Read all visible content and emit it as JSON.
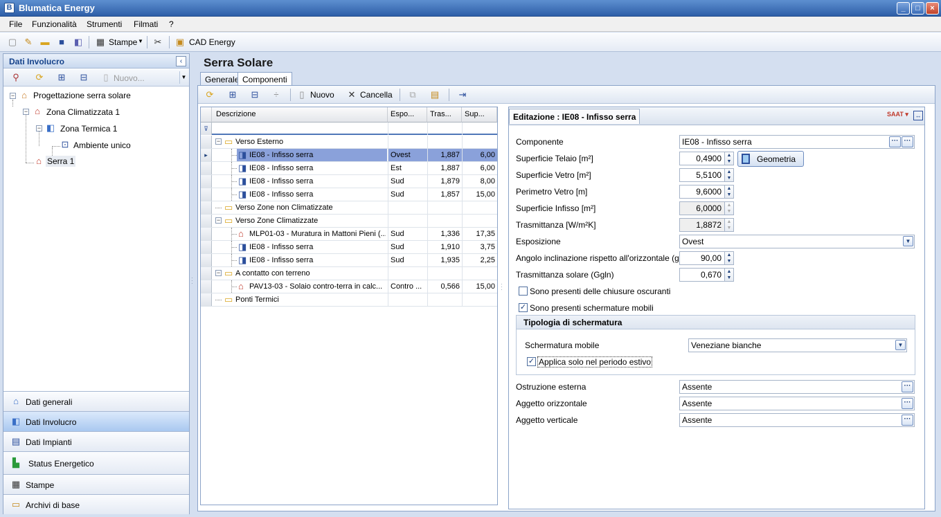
{
  "window": {
    "title": "Blumatica Energy"
  },
  "menu": [
    {
      "label": "File"
    },
    {
      "label": "Funzionalità"
    },
    {
      "label": "Strumenti"
    },
    {
      "label": "Filmati"
    },
    {
      "label": "?"
    }
  ],
  "toolbar": {
    "stampe_label": "Stampe",
    "cad_label": "CAD Energy"
  },
  "left_panel": {
    "title": "Dati Involucro",
    "nuovo_label": "Nuovo...",
    "tree": [
      {
        "label": "Progettazione serra solare"
      },
      {
        "label": "Zona Climatizzata 1"
      },
      {
        "label": "Zona Termica 1"
      },
      {
        "label": "Ambiente unico"
      },
      {
        "label": "Serra 1"
      }
    ],
    "nav": [
      {
        "label": "Dati generali"
      },
      {
        "label": "Dati Involucro"
      },
      {
        "label": "Dati Impianti"
      },
      {
        "label": "Status Energetico"
      },
      {
        "label": "Stampe"
      },
      {
        "label": "Archivi di base"
      }
    ]
  },
  "page": {
    "title": "Serra Solare"
  },
  "tabs": [
    {
      "label": "Generale"
    },
    {
      "label": "Componenti"
    }
  ],
  "inner_toolbar": {
    "nuovo_label": "Nuovo",
    "cancella_label": "Cancella"
  },
  "grid": {
    "headers": [
      "Descrizione",
      "Espo...",
      "Tras...",
      "Sup..."
    ],
    "rows": [
      {
        "desc": "Verso Esterno",
        "espo": "",
        "tras": "",
        "sup": ""
      },
      {
        "desc": "IE08 - Infisso serra",
        "espo": "Ovest",
        "tras": "1,887",
        "sup": "6,00"
      },
      {
        "desc": "IE08 - Infisso serra",
        "espo": "Est",
        "tras": "1,887",
        "sup": "6,00"
      },
      {
        "desc": "IE08 - Infisso serra",
        "espo": "Sud",
        "tras": "1,879",
        "sup": "8,00"
      },
      {
        "desc": "IE08 - Infisso serra",
        "espo": "Sud",
        "tras": "1,857",
        "sup": "15,00"
      },
      {
        "desc": "Verso Zone non Climatizzate",
        "espo": "",
        "tras": "",
        "sup": ""
      },
      {
        "desc": "Verso Zone Climatizzate",
        "espo": "",
        "tras": "",
        "sup": ""
      },
      {
        "desc": "MLP01-03 - Muratura in Mattoni Pieni (...",
        "espo": "Sud",
        "tras": "1,336",
        "sup": "17,35"
      },
      {
        "desc": "IE08 - Infisso serra",
        "espo": "Sud",
        "tras": "1,910",
        "sup": "3,75"
      },
      {
        "desc": "IE08 - Infisso serra",
        "espo": "Sud",
        "tras": "1,935",
        "sup": "2,25"
      },
      {
        "desc": "A contatto con terreno",
        "espo": "",
        "tras": "",
        "sup": ""
      },
      {
        "desc": "PAV13-03 - Solaio contro-terra in calc...",
        "espo": "Contro ...",
        "tras": "0,566",
        "sup": "15,00"
      },
      {
        "desc": "Ponti Termici",
        "espo": "",
        "tras": "",
        "sup": ""
      }
    ]
  },
  "editor": {
    "title": "Editazione : IE08 - Infisso serra",
    "componente_label": "Componente",
    "componente_value": "IE08 - Infisso serra",
    "sup_telaio_label": "Superficie Telaio [m²]",
    "sup_telaio_value": "0,4900",
    "geometria_label": "Geometria",
    "sup_vetro_label": "Superficie Vetro [m²]",
    "sup_vetro_value": "5,5100",
    "perimetro_label": "Perimetro Vetro [m]",
    "perimetro_value": "9,6000",
    "sup_infisso_label": "Superficie Infisso [m²]",
    "sup_infisso_value": "6,0000",
    "trasmittanza_label": "Trasmittanza [W/m²K]",
    "trasmittanza_value": "1,8872",
    "esposizione_label": "Esposizione",
    "esposizione_value": "Ovest",
    "angolo_label": "Angolo inclinazione rispetto all'orizzontale (gradi)",
    "angolo_value": "90,00",
    "trasm_solare_label": "Trasmittanza solare (Ggln)",
    "trasm_solare_value": "0,670",
    "chiusure_label": "Sono presenti delle chiusure oscuranti",
    "chiusure_checked": false,
    "schermature_label": "Sono presenti schermature mobili",
    "schermature_checked": true,
    "tipologia_title": "Tipologia di schermatura",
    "scherm_mobile_label": "Schermatura mobile",
    "scherm_mobile_value": "Veneziane bianche",
    "applica_label": "Applica solo nel periodo estivo",
    "applica_checked": true,
    "ostruzione_label": "Ostruzione esterna",
    "ostruzione_value": "Assente",
    "aggetto_orizz_label": "Aggetto orizzontale",
    "aggetto_orizz_value": "Assente",
    "aggetto_vert_label": "Aggetto verticale",
    "aggetto_vert_value": "Assente"
  }
}
